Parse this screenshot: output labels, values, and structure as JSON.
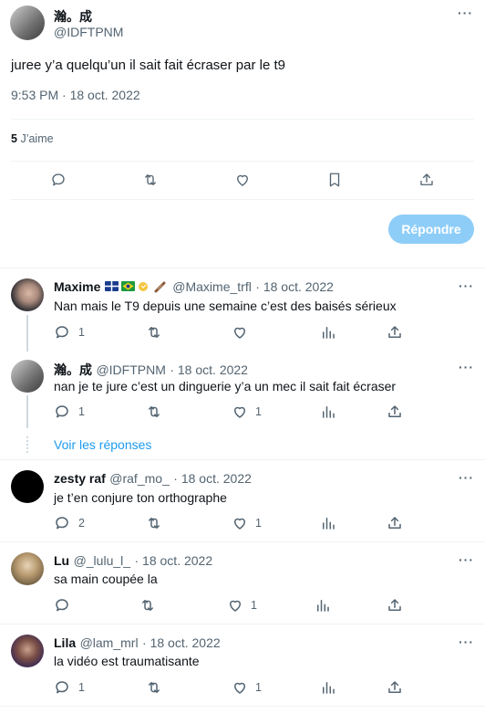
{
  "main_tweet": {
    "name": "瀚。成",
    "handle": "@IDFTPNM",
    "text": "juree y’a quelqu’un il sait fait écraser par le t9",
    "timestamp": "9:53 PM · 18 oct. 2022",
    "likes_count": "5",
    "likes_label": "J’aime",
    "reply_button": "Répondre"
  },
  "replies": [
    {
      "name": "Maxime",
      "handle": "@Maxime_trfl",
      "date": "· 18 oct. 2022",
      "text": "Nan mais le T9 depuis une semaine c’est des baisés sérieux",
      "replies": "1",
      "likes": ""
    },
    {
      "name": "瀚。成",
      "handle": "@IDFTPNM",
      "date": "· 18 oct. 2022",
      "text": "nan je te jure c’est un dinguerie y’a un mec il sait fait écraser",
      "replies": "1",
      "likes": "1"
    },
    {
      "name": "zesty raf",
      "handle": "@raf_mo_",
      "date": "· 18 oct. 2022",
      "text": "je t’en conjure ton orthographe",
      "replies": "2",
      "likes": "1"
    },
    {
      "name": "Lu",
      "handle": "@_lulu_l_",
      "date": "· 18 oct. 2022",
      "text": "sa main coupée la",
      "replies": "",
      "likes": "1"
    },
    {
      "name": "Lila",
      "handle": "@lam_mrl",
      "date": "· 18 oct. 2022",
      "text": "la vidéo est traumatisante",
      "replies": "1",
      "likes": "1"
    }
  ],
  "show_replies": "Voir les réponses",
  "more_label": "···",
  "colors": {
    "accent": "#1d9bf0",
    "reply_button": "#8ecdf8",
    "muted": "#536471"
  }
}
